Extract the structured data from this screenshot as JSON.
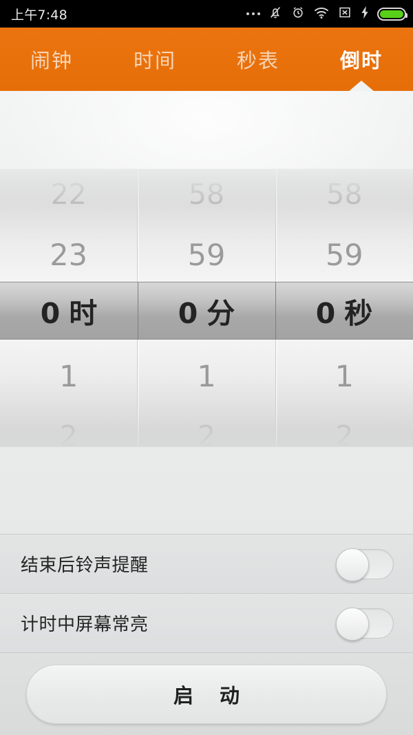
{
  "status_bar": {
    "time": "上午7:48",
    "icons": [
      {
        "name": "more-dots-icon",
        "glyph": "…"
      },
      {
        "name": "bell-muted-icon",
        "glyph": "bell-slash"
      },
      {
        "name": "alarm-clock-icon",
        "glyph": "alarm"
      },
      {
        "name": "wifi-icon",
        "glyph": "wifi"
      },
      {
        "name": "no-sim-icon",
        "glyph": "x-box"
      },
      {
        "name": "charging-bolt-icon",
        "glyph": "bolt"
      },
      {
        "name": "battery-icon",
        "glyph": "battery-full"
      }
    ],
    "battery_color": "#58d017",
    "background": "#000000"
  },
  "tabs": {
    "accent": "#e6700c",
    "items": [
      {
        "label": "闹钟",
        "active": false
      },
      {
        "label": "时间",
        "active": false
      },
      {
        "label": "秒表",
        "active": false
      },
      {
        "label": "倒时",
        "active": true
      }
    ]
  },
  "picker": {
    "columns": [
      {
        "name": "hours",
        "unit": "时",
        "selected": "0",
        "above_far": "22",
        "above_near": "23",
        "below_near": "1",
        "below_far": "2"
      },
      {
        "name": "minutes",
        "unit": "分",
        "selected": "0",
        "above_far": "58",
        "above_near": "59",
        "below_near": "1",
        "below_far": "2"
      },
      {
        "name": "seconds",
        "unit": "秒",
        "selected": "0",
        "above_far": "58",
        "above_near": "59",
        "below_near": "1",
        "below_far": "2"
      }
    ]
  },
  "settings": {
    "rows": [
      {
        "label": "结束后铃声提醒",
        "toggle_on": false
      },
      {
        "label": "计时中屏幕常亮",
        "toggle_on": false
      }
    ]
  },
  "footer": {
    "start_label": "启 动"
  }
}
